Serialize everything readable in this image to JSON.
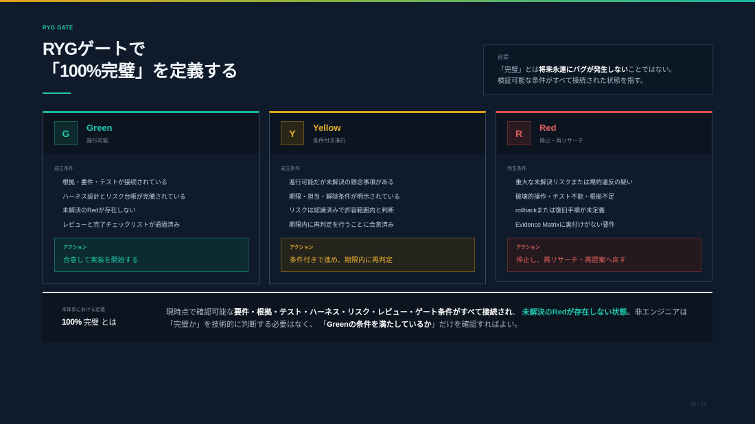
{
  "eyebrow": "RYG GATE",
  "title": {
    "line1_latin": "RYG",
    "line1_rest": "ゲートで",
    "line2_open": "「",
    "line2_num": "100%",
    "line2_rest": "完璧」を定義する"
  },
  "premise": {
    "label": "前提",
    "pre": "「完璧」とは",
    "bold": "将来永遠にバグが発生しない",
    "post": "ことではない。",
    "line2": "検証可能な条件がすべて接続された状態を指す。"
  },
  "cards": [
    {
      "badge": "G",
      "name": "Green",
      "sub": "進行可能",
      "cond_label": "成立条件",
      "conditions": [
        "根拠・要件・テストが接続されている",
        "ハーネス設計とリスク台帳が完備されている",
        "未解決のRedが存在しない",
        "レビューと完了チェックリストが通過済み"
      ],
      "action_label": "アクション",
      "action": "合意して実装を開始する"
    },
    {
      "badge": "Y",
      "name": "Yellow",
      "sub": "条件付き進行",
      "cond_label": "成立条件",
      "conditions": [
        "進行可能だが未解決の懸念事項がある",
        "期限・担当・解除条件が明示されている",
        "リスクは認識済みで許容範囲内と判断",
        "期限内に再判定を行うことに合意済み"
      ],
      "action_label": "アクション",
      "action": "条件付きで進め、期限内に再判定"
    },
    {
      "badge": "R",
      "name": "Red",
      "sub": "停止・再リサーチ",
      "cond_label": "発生条件",
      "conditions": [
        "重大な未解決リスクまたは規約違反の疑い",
        "破壊的操作・テスト不能・根拠不足",
        "rollbackまたは復旧手順が未定義",
        "Evidence Matrixに裏付けがない要件"
      ],
      "action_label": "アクション",
      "action": "停止し、再リサーチ・再提案へ戻す"
    }
  ],
  "definition": {
    "label": "本体系における定義",
    "head_bold": "100%",
    "head_rest": "完璧 とは",
    "p1": "現時点で確認可能な",
    "b1": "要件・根拠・テスト・ハーネス・リスク・レビュー・ゲート条件がすべて接続され",
    "p2": "、 ",
    "accent": "未解決のRedが存在しない状態",
    "p3": "。非エンジニアは",
    "p4": "「完璧か」を技術的に判断する必要はなく、 「",
    "b2": "Greenの条件を満たしているか",
    "p5": "」だけを確認すればよい。"
  },
  "page": "09 / 12",
  "colors": {
    "green": "#17b6a0",
    "yellow": "#e3a21a",
    "red": "#d9534f",
    "background": "#0f1b2b"
  }
}
